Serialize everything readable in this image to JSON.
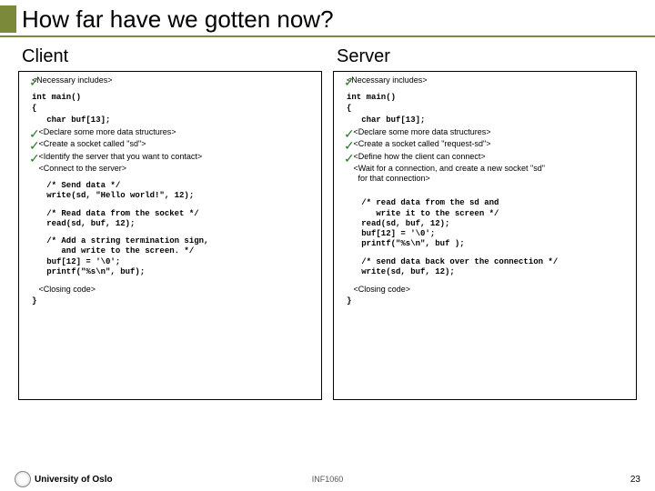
{
  "title": "How far have we gotten now?",
  "client": {
    "heading": "Client",
    "necessary": "<Necessary includes>",
    "main_open": "int main()\n{",
    "buf": "   char buf[13];",
    "declare": "   <Declare some more data structures>",
    "socket": "   <Create a socket called \"sd\">",
    "identify": "   <Identify the server that you want to contact>",
    "connect": "   <Connect to the server>",
    "send": "   /* Send data */\n   write(sd, \"Hello world!\", 12);",
    "read": "   /* Read data from the socket */\n   read(sd, buf, 12);",
    "term": "   /* Add a string termination sign,\n      and write to the screen. */\n   buf[12] = '\\0';\n   printf(\"%s\\n\", buf);",
    "closing": "   <Closing code>",
    "brace": "}"
  },
  "server": {
    "heading": "Server",
    "necessary": "<Necessary includes>",
    "main_open": "int main()\n{",
    "buf": "   char buf[13];",
    "declare": "   <Declare some more data structures>",
    "socket": "   <Create a socket called \"request-sd\">",
    "define": "   <Define how the client can connect>",
    "wait": "   <Wait for a connection, and create a new socket \"sd\"\n     for that connection>",
    "read": "   /* read data from the sd and\n      write it to the screen */\n   read(sd, buf, 12);\n   buf[12] = '\\0';\n   printf(\"%s\\n\", buf );",
    "send": "   /* send data back over the connection */\n   write(sd, buf, 12);",
    "closing": "   <Closing code>",
    "brace": "}"
  },
  "footer": {
    "left": "University of Oslo",
    "center": "INF1060",
    "right": "23"
  }
}
